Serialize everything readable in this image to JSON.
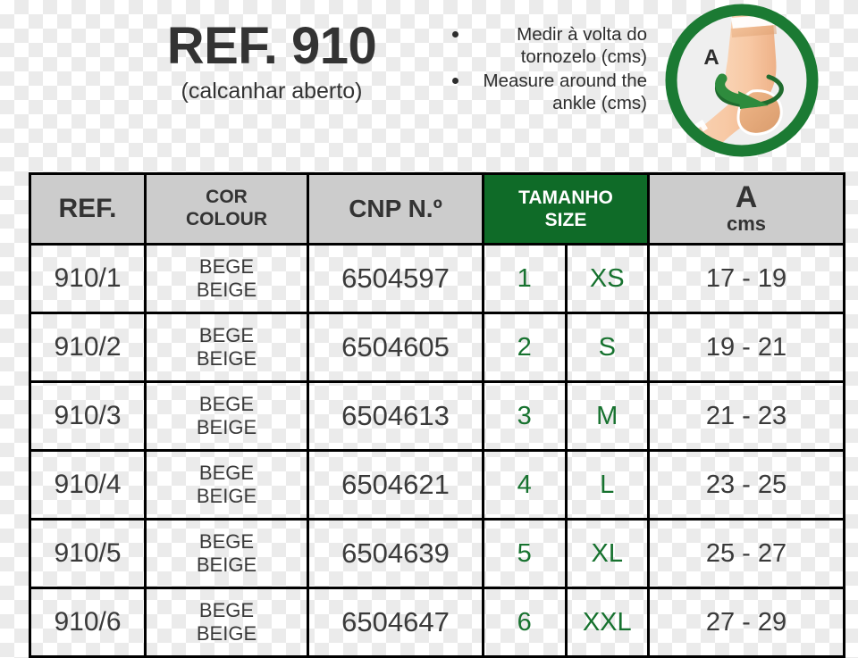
{
  "header": {
    "title": "REF. 910",
    "subtitle": "(calcanhar aberto)",
    "instructions": [
      "Medir à volta do tornozelo (cms)",
      "Measure around the ankle (cms)"
    ],
    "illustration": {
      "label": "A",
      "icon": "ankle-measure-icon",
      "ring_color": "#1b7a33",
      "arrow_color": "#2e8b3d",
      "skin_color": "#f7c9a4",
      "support_color": "#f2b98a"
    }
  },
  "table": {
    "columns": [
      {
        "key": "ref",
        "label": "REF."
      },
      {
        "key": "colour",
        "label_pt": "COR",
        "label_en": "COLOUR"
      },
      {
        "key": "cnp",
        "label": "CNP N.º"
      },
      {
        "key": "size",
        "label_pt": "TAMANHO",
        "label_en": "SIZE",
        "background": "#0f6b28"
      },
      {
        "key": "a",
        "label": "A",
        "unit": "cms"
      }
    ],
    "rows": [
      {
        "ref": "910/1",
        "colour_pt": "BEGE",
        "colour_en": "BEIGE",
        "cnp": "6504597",
        "size_num": "1",
        "size_letter": "XS",
        "a_cms": "17 - 19"
      },
      {
        "ref": "910/2",
        "colour_pt": "BEGE",
        "colour_en": "BEIGE",
        "cnp": "6504605",
        "size_num": "2",
        "size_letter": "S",
        "a_cms": "19 - 21"
      },
      {
        "ref": "910/3",
        "colour_pt": "BEGE",
        "colour_en": "BEIGE",
        "cnp": "6504613",
        "size_num": "3",
        "size_letter": "M",
        "a_cms": "21 - 23"
      },
      {
        "ref": "910/4",
        "colour_pt": "BEGE",
        "colour_en": "BEIGE",
        "cnp": "6504621",
        "size_num": "4",
        "size_letter": "L",
        "a_cms": "23 - 25"
      },
      {
        "ref": "910/5",
        "colour_pt": "BEGE",
        "colour_en": "BEIGE",
        "cnp": "6504639",
        "size_num": "5",
        "size_letter": "XL",
        "a_cms": "25 - 27"
      },
      {
        "ref": "910/6",
        "colour_pt": "BEGE",
        "colour_en": "BEIGE",
        "cnp": "6504647",
        "size_num": "6",
        "size_letter": "XXL",
        "a_cms": "27 - 29"
      }
    ]
  },
  "colors": {
    "green": "#0f6b28",
    "green_text": "#17722f",
    "header_gray": "#cccccc",
    "text_dark": "#333333"
  }
}
